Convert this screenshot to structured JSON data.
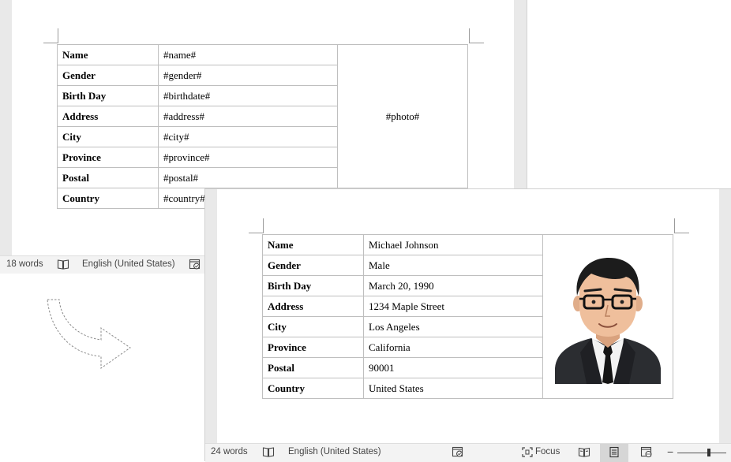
{
  "template_window": {
    "rows": [
      {
        "label": "Name",
        "value": "#name#"
      },
      {
        "label": "Gender",
        "value": "#gender#"
      },
      {
        "label": "Birth Day",
        "value": "#birthdate#"
      },
      {
        "label": "Address",
        "value": "#address#"
      },
      {
        "label": "City",
        "value": "#city#"
      },
      {
        "label": "Province",
        "value": "#province#"
      },
      {
        "label": "Postal",
        "value": "#postal#"
      },
      {
        "label": "Country",
        "value": "#country#"
      }
    ],
    "photo_placeholder": "#photo#",
    "status": {
      "word_count": "18 words",
      "language": "English (United States)"
    }
  },
  "result_window": {
    "rows": [
      {
        "label": "Name",
        "value": "Michael Johnson"
      },
      {
        "label": "Gender",
        "value": "Male"
      },
      {
        "label": "Birth Day",
        "value": "March 20, 1990"
      },
      {
        "label": "Address",
        "value": "1234 Maple Street"
      },
      {
        "label": "City",
        "value": "Los Angeles"
      },
      {
        "label": "Province",
        "value": "California"
      },
      {
        "label": "Postal",
        "value": "90001"
      },
      {
        "label": "Country",
        "value": "United States"
      }
    ],
    "status": {
      "word_count": "24 words",
      "language": "English (United States)",
      "focus_label": "Focus"
    }
  },
  "icons": {
    "proofing": "book-check-icon",
    "accessibility": "accessibility-icon",
    "focus": "focus-icon",
    "read_mode": "read-mode-icon",
    "print_layout": "print-layout-icon",
    "web_layout": "web-layout-icon",
    "zoom_out": "minus-icon",
    "zoom_in": "plus-icon",
    "transform_arrow": "curved-arrow-icon"
  },
  "colors": {
    "status_bg": "#f3f3f3",
    "gutter": "#e9e9e9",
    "table_border": "#bfbfbf"
  }
}
